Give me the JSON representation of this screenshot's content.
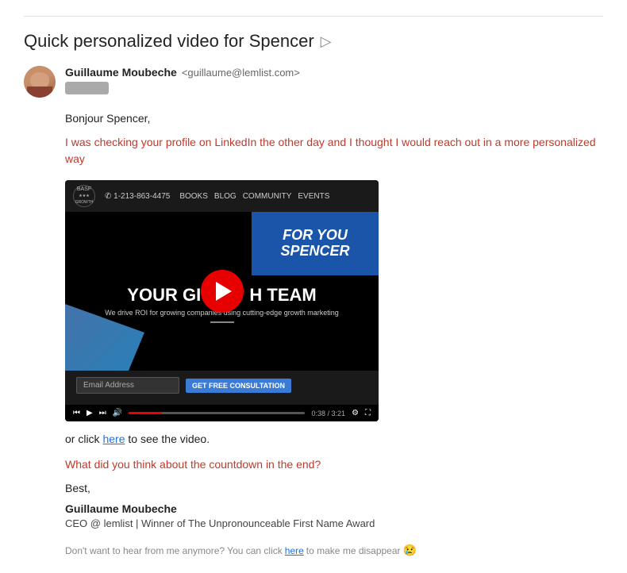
{
  "header": {
    "title": "Quick personalized video for Spencer",
    "forward_icon": "▷"
  },
  "sender": {
    "name": "Guillaume Moubeche",
    "email": "<guillaume@lemlist.com>",
    "tag_label": ""
  },
  "body": {
    "greeting": "Bonjour Spencer,",
    "intro": "I was checking your profile on LinkedIn the other day and I thought I would reach out in a more personalized way",
    "click_here_prefix": "or click ",
    "click_here_link": "here",
    "click_here_suffix": " to see the video.",
    "question": "What did you think about the countdown in the end?",
    "best": "Best,",
    "signature_name": "Guillaume Moubeche",
    "signature_title": "CEO @ lemlist | Winner of The Unpronounceable First Name Award",
    "unsubscribe_prefix": "Don't want to hear from me anymore? You can click ",
    "unsubscribe_link": "here",
    "unsubscribe_suffix": " to make me disappear",
    "unsubscribe_emoji": "😢"
  },
  "video": {
    "phone": "✆ 1-213-863-4475",
    "nav_items": [
      "BOOKS",
      "BLOG",
      "COMMUNITY",
      "EVENTS"
    ],
    "for_you_line1": "FOR YOU",
    "for_you_line2": "SPENCER",
    "main_text_line1": "YOUR GI",
    "main_text_line2": "H TEAM",
    "tagline": "We drive ROI for growing companies using cutting-edge growth marketing",
    "email_placeholder": "Email Address",
    "cta_button": "GET FREE CONSULTATION",
    "time_current": "0:38",
    "time_total": "3:21"
  },
  "icons": {
    "forward": "▷",
    "play": "▶",
    "settings": "⚙",
    "fullscreen": "⛶",
    "volume": "🔊"
  }
}
